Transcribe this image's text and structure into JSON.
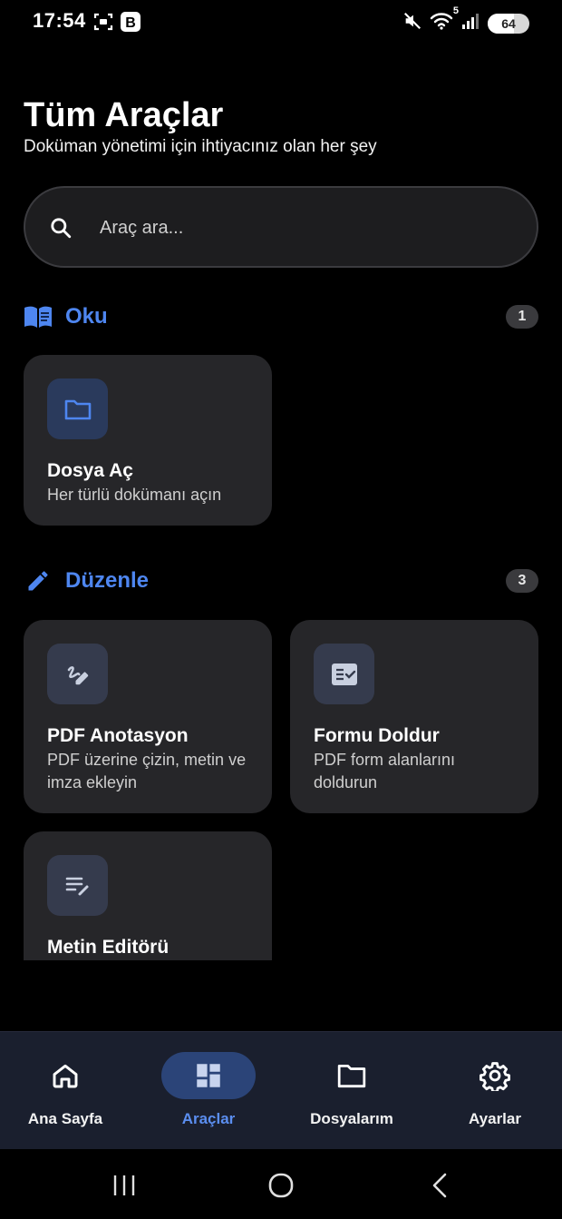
{
  "status_bar": {
    "time": "17:54",
    "battery": "64",
    "wifi_badge": "5",
    "icons": [
      "screenshot-icon",
      "b-app-icon",
      "mute-icon",
      "wifi-icon",
      "signal-icon",
      "battery-icon"
    ]
  },
  "header": {
    "title": "Tüm Araçlar",
    "subtitle": "Doküman yönetimi için ihtiyacınız olan her şey"
  },
  "search": {
    "placeholder": "Araç ara..."
  },
  "sections": [
    {
      "title": "Oku",
      "count": "1",
      "icon": "book-icon",
      "tools": [
        {
          "title": "Dosya Aç",
          "description": "Her türlü dokümanı açın",
          "icon": "folder-icon"
        }
      ]
    },
    {
      "title": "Düzenle",
      "count": "3",
      "icon": "pencil-icon",
      "tools": [
        {
          "title": "PDF Anotasyon",
          "description": "PDF üzerine çizin, metin ve imza ekleyin",
          "icon": "draw-icon"
        },
        {
          "title": "Formu Doldur",
          "description": "PDF form alanlarını doldurun",
          "icon": "form-check-icon"
        },
        {
          "title": "Metin Editörü",
          "description": "",
          "icon": "text-edit-icon"
        }
      ]
    }
  ],
  "bottom_nav": {
    "items": [
      {
        "label": "Ana Sayfa",
        "icon": "home-icon",
        "active": false
      },
      {
        "label": "Araçlar",
        "icon": "dashboard-icon",
        "active": true
      },
      {
        "label": "Dosyalarım",
        "icon": "folder-icon",
        "active": false
      },
      {
        "label": "Ayarlar",
        "icon": "gear-icon",
        "active": false
      }
    ]
  },
  "system_nav": [
    "recents-icon",
    "home-circle-icon",
    "back-icon"
  ],
  "colors": {
    "accent": "#4e86f0",
    "background": "#000000",
    "card": "#262629",
    "nav_bar": "#1a1f2e",
    "active_pill": "#2b4478"
  }
}
